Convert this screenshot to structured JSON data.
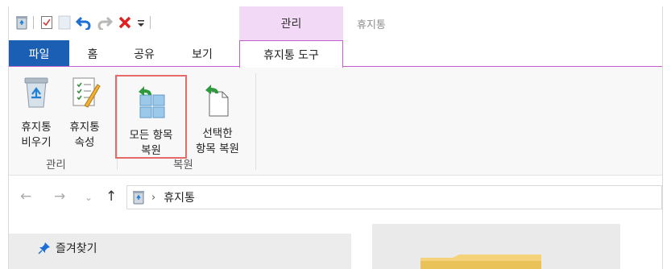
{
  "titlebar": {
    "context_group": "관리",
    "window_title": "휴지통",
    "qat_icons": [
      "recycle-bin-icon",
      "properties-icon",
      "new-folder-icon",
      "undo-icon",
      "redo-icon",
      "delete-icon",
      "customize-dropdown-icon"
    ]
  },
  "tabs": [
    {
      "label": "파일"
    },
    {
      "label": "홈"
    },
    {
      "label": "공유"
    },
    {
      "label": "보기"
    },
    {
      "label": "휴지통 도구",
      "active": true
    }
  ],
  "ribbon": {
    "groups": [
      {
        "label": "관리",
        "buttons": [
          {
            "line1": "휴지통",
            "line2": "비우기",
            "icon": "empty-recycle-bin-icon"
          },
          {
            "line1": "휴지통",
            "line2": "속성",
            "icon": "recycle-bin-properties-icon"
          }
        ]
      },
      {
        "label": "복원",
        "buttons": [
          {
            "line1": "모든 항목",
            "line2": "복원",
            "icon": "restore-all-items-icon",
            "highlighted": true
          },
          {
            "line1": "선택한",
            "line2": "항목 복원",
            "icon": "restore-selected-items-icon"
          }
        ]
      }
    ]
  },
  "address": {
    "nav_icons": [
      "back-arrow-icon",
      "forward-arrow-icon",
      "recent-dropdown-icon",
      "up-arrow-icon"
    ],
    "path": "휴지통"
  },
  "navpane": {
    "favorites_label": "즐겨찾기"
  },
  "colors": {
    "file_tab": "#1a5fb4",
    "context_group_bg": "#f2d9f6",
    "context_border": "#c45fcf",
    "highlight_border": "#e66a6a"
  }
}
